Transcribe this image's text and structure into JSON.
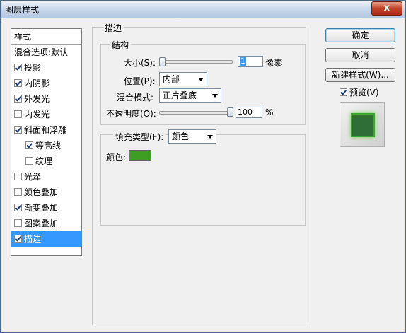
{
  "window": {
    "title": "图层样式",
    "close": "x"
  },
  "left_panel": {
    "header": "样式",
    "items": [
      {
        "label": "混合选项:默认",
        "checkbox": false,
        "checked": false,
        "indent": false,
        "selected": false
      },
      {
        "label": "投影",
        "checkbox": true,
        "checked": true,
        "indent": false,
        "selected": false
      },
      {
        "label": "内阴影",
        "checkbox": true,
        "checked": true,
        "indent": false,
        "selected": false
      },
      {
        "label": "外发光",
        "checkbox": true,
        "checked": true,
        "indent": false,
        "selected": false
      },
      {
        "label": "内发光",
        "checkbox": true,
        "checked": false,
        "indent": false,
        "selected": false
      },
      {
        "label": "斜面和浮雕",
        "checkbox": true,
        "checked": true,
        "indent": false,
        "selected": false
      },
      {
        "label": "等高线",
        "checkbox": true,
        "checked": true,
        "indent": true,
        "selected": false
      },
      {
        "label": "纹理",
        "checkbox": true,
        "checked": false,
        "indent": true,
        "selected": false
      },
      {
        "label": "光泽",
        "checkbox": true,
        "checked": false,
        "indent": false,
        "selected": false
      },
      {
        "label": "颜色叠加",
        "checkbox": true,
        "checked": false,
        "indent": false,
        "selected": false
      },
      {
        "label": "渐变叠加",
        "checkbox": true,
        "checked": true,
        "indent": false,
        "selected": false
      },
      {
        "label": "图案叠加",
        "checkbox": true,
        "checked": false,
        "indent": false,
        "selected": false
      },
      {
        "label": "描边",
        "checkbox": true,
        "checked": true,
        "indent": false,
        "selected": true
      }
    ]
  },
  "stroke": {
    "group_title": "描边",
    "structure_title": "结构",
    "size_label": "大小(S):",
    "size_value": "1",
    "size_unit": "像素",
    "position_label": "位置(P):",
    "position_value": "内部",
    "blend_label": "混合模式:",
    "blend_value": "正片叠底",
    "opacity_label": "不透明度(O):",
    "opacity_value": "100",
    "opacity_unit": "%",
    "opacity_level": 1.0,
    "size_level": 0.0
  },
  "fill": {
    "type_label": "填充类型(F):",
    "type_value": "颜色",
    "color_label": "颜色:",
    "color": "#3e9e24"
  },
  "buttons": {
    "ok": "确定",
    "cancel": "取消",
    "new_style": "新建样式(W)...",
    "preview": "预览(V)",
    "preview_checked": true
  },
  "colors": {
    "selected": "#3399ff",
    "preview_fill": "#2f6e34",
    "preview_stroke": "#3aa82a"
  }
}
